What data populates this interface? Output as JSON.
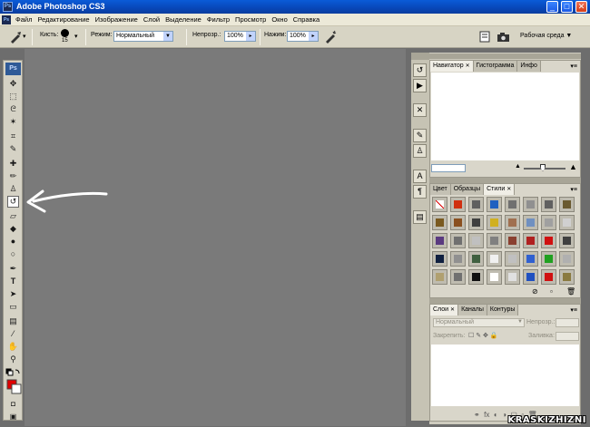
{
  "app": {
    "title": "Adobe Photoshop CS3",
    "icon_text": "Ps"
  },
  "window_buttons": [
    "_",
    "□",
    "✕"
  ],
  "menu": [
    "Файл",
    "Редактирование",
    "Изображение",
    "Слой",
    "Выделение",
    "Фильтр",
    "Просмотр",
    "Окно",
    "Справка"
  ],
  "options": {
    "brush_label": "Кисть:",
    "brush_size": "15",
    "mode_label": "Режим:",
    "mode_value": "Нормальный",
    "opacity_label": "Непрозр.:",
    "opacity_value": "100%",
    "pressure_label": "Нажим:",
    "pressure_value": "100%",
    "workspace_label": "Рабочая среда ▼"
  },
  "toolbox": {
    "badge": "Ps",
    "tools": [
      {
        "name": "move-tool-icon",
        "glyph": "✥"
      },
      {
        "name": "marquee-tool-icon",
        "glyph": "⬚"
      },
      {
        "name": "lasso-tool-icon",
        "glyph": "ᘓ"
      },
      {
        "name": "magic-wand-tool-icon",
        "glyph": "✶"
      },
      {
        "name": "crop-tool-icon",
        "glyph": "⌗"
      },
      {
        "name": "slice-tool-icon",
        "glyph": "✎"
      },
      {
        "name": "healing-brush-tool-icon",
        "glyph": "✚"
      },
      {
        "name": "brush-tool-icon",
        "glyph": "✏"
      },
      {
        "name": "clone-stamp-tool-icon",
        "glyph": "♙"
      },
      {
        "name": "history-brush-tool-icon",
        "glyph": "↺"
      },
      {
        "name": "eraser-tool-icon",
        "glyph": "▱"
      },
      {
        "name": "paint-bucket-tool-icon",
        "glyph": "◆"
      },
      {
        "name": "blur-tool-icon",
        "glyph": "●"
      },
      {
        "name": "dodge-tool-icon",
        "glyph": "○"
      },
      {
        "name": "pen-tool-icon",
        "glyph": "✒"
      },
      {
        "name": "type-tool-icon",
        "glyph": "T"
      },
      {
        "name": "path-selection-tool-icon",
        "glyph": "➤"
      },
      {
        "name": "rectangle-tool-icon",
        "glyph": "▭"
      },
      {
        "name": "notes-tool-icon",
        "glyph": "▤"
      },
      {
        "name": "eyedropper-tool-icon",
        "glyph": "⁄"
      },
      {
        "name": "hand-tool-icon",
        "glyph": "✋"
      },
      {
        "name": "zoom-tool-icon",
        "glyph": "⚲"
      }
    ],
    "foreground_color": "#e00000",
    "background_color": "#ffffff"
  },
  "panels": {
    "navigator": {
      "tabs": [
        "Навигатор",
        "Гистограмма",
        "Инфо"
      ]
    },
    "styles": {
      "tabs": [
        "Цвет",
        "Образцы",
        "Стили"
      ]
    },
    "layers": {
      "tabs": [
        "Слои",
        "Каналы",
        "Контуры"
      ],
      "blend_mode": "Нормальный",
      "opacity_label": "Непрозр.:",
      "lock_label": "Закрепить:",
      "fill_label": "Заливка:"
    }
  },
  "style_swatches": [
    "#ffffff",
    "#d03010",
    "#606060",
    "#2060c0",
    "#707070",
    "#909090",
    "#606060",
    "#6a5a30",
    "#7a5a20",
    "#8a5020",
    "#404040",
    "#d0b020",
    "#a07050",
    "#7090c0",
    "#a0a0a0",
    "#d0d0d0",
    "#5a3a80",
    "#707070",
    "#c0c0c0",
    "#808080",
    "#8a4030",
    "#b02020",
    "#d01010",
    "#404040",
    "#102040",
    "#909090",
    "#406040",
    "#f0f0f0",
    "#c0c0c0",
    "#3060d0",
    "#20a020",
    "#b0b0b0",
    "#b0a070",
    "#707070",
    "#101010",
    "#ffffff",
    "#e0e0e0",
    "#2050c0",
    "#d01010",
    "#8a7a40"
  ],
  "watermark": "KRASKIZHIZNI"
}
